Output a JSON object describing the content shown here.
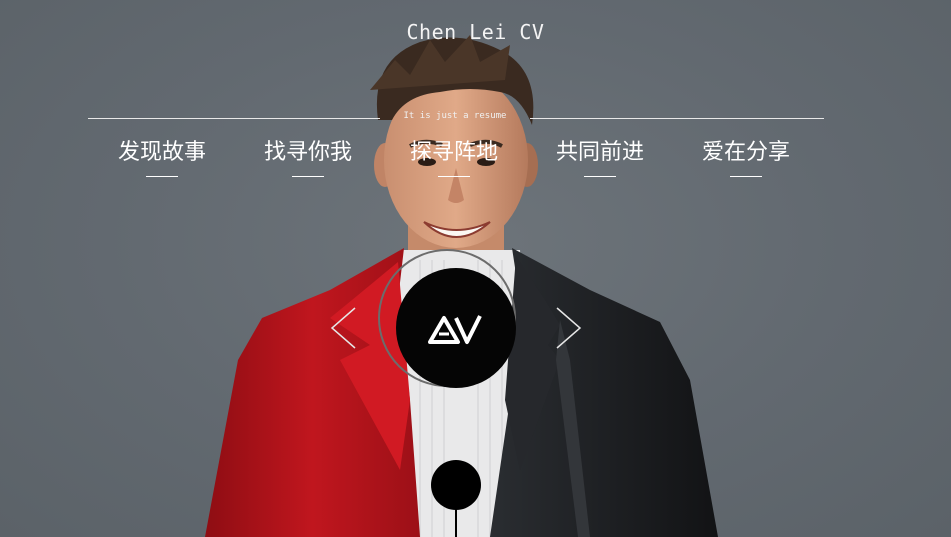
{
  "header": {
    "title": "Chen Lei CV",
    "subtitle": "It is just a resume"
  },
  "nav": {
    "items": [
      {
        "label": "发现故事"
      },
      {
        "label": "找寻你我"
      },
      {
        "label": "探寻阵地"
      },
      {
        "label": "共同前进"
      },
      {
        "label": "爱在分享"
      }
    ]
  },
  "carousel": {
    "prev_icon": "chevron-left-icon",
    "next_icon": "chevron-right-icon",
    "logo_icon": "av-logo-icon"
  },
  "colors": {
    "background": "#656c72",
    "text": "#ffffff",
    "jacket_red": "#b3141c",
    "jacket_black": "#1b1d20",
    "logo_bg": "#050505"
  }
}
